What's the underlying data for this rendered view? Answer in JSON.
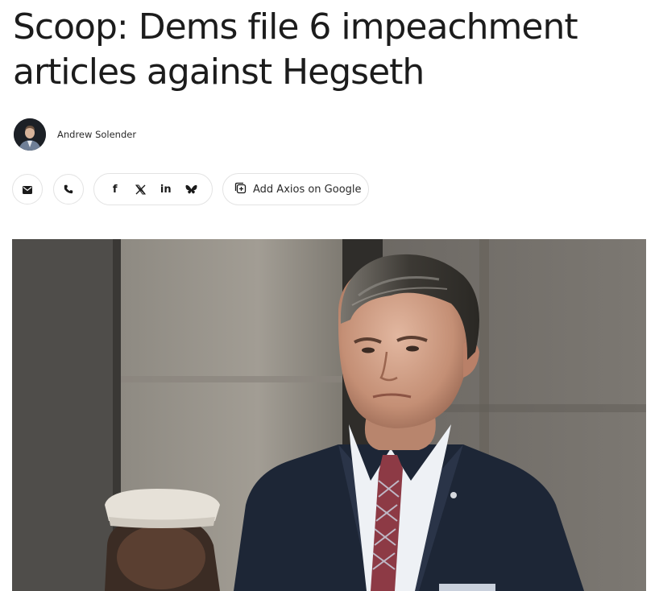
{
  "article": {
    "headline": "Scoop: Dems file 6 impeachment articles against Hegseth",
    "author": "Andrew Solender"
  },
  "share": {
    "email_icon": "envelope-icon",
    "phone_icon": "phone-icon",
    "social": [
      {
        "name": "facebook",
        "glyph": "f"
      },
      {
        "name": "x",
        "glyph": "𝕏"
      },
      {
        "name": "linkedin",
        "glyph": "in"
      },
      {
        "name": "bluesky",
        "glyph": "butterfly"
      }
    ],
    "google_label": "Add Axios on Google"
  },
  "hero_image": {
    "subject": "photo-man-in-suit"
  }
}
